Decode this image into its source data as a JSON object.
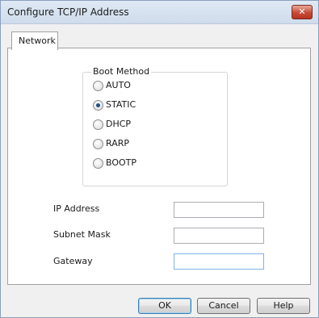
{
  "window": {
    "title": "Configure TCP/IP Address",
    "close_glyph": "✕"
  },
  "tabs": [
    {
      "label": "Network"
    }
  ],
  "boot_method": {
    "label": "Boot Method",
    "options": [
      {
        "label": "AUTO",
        "selected": false
      },
      {
        "label": "STATIC",
        "selected": true
      },
      {
        "label": "DHCP",
        "selected": false
      },
      {
        "label": "RARP",
        "selected": false
      },
      {
        "label": "BOOTP",
        "selected": false
      }
    ]
  },
  "fields": {
    "ip_address": {
      "label": "IP Address",
      "value": ""
    },
    "subnet_mask": {
      "label": "Subnet Mask",
      "value": ""
    },
    "gateway": {
      "label": "Gateway",
      "value": ""
    }
  },
  "buttons": {
    "ok": "OK",
    "cancel": "Cancel",
    "help": "Help"
  },
  "colors": {
    "accent": "#1d4f8a",
    "close": "#c74a35"
  }
}
